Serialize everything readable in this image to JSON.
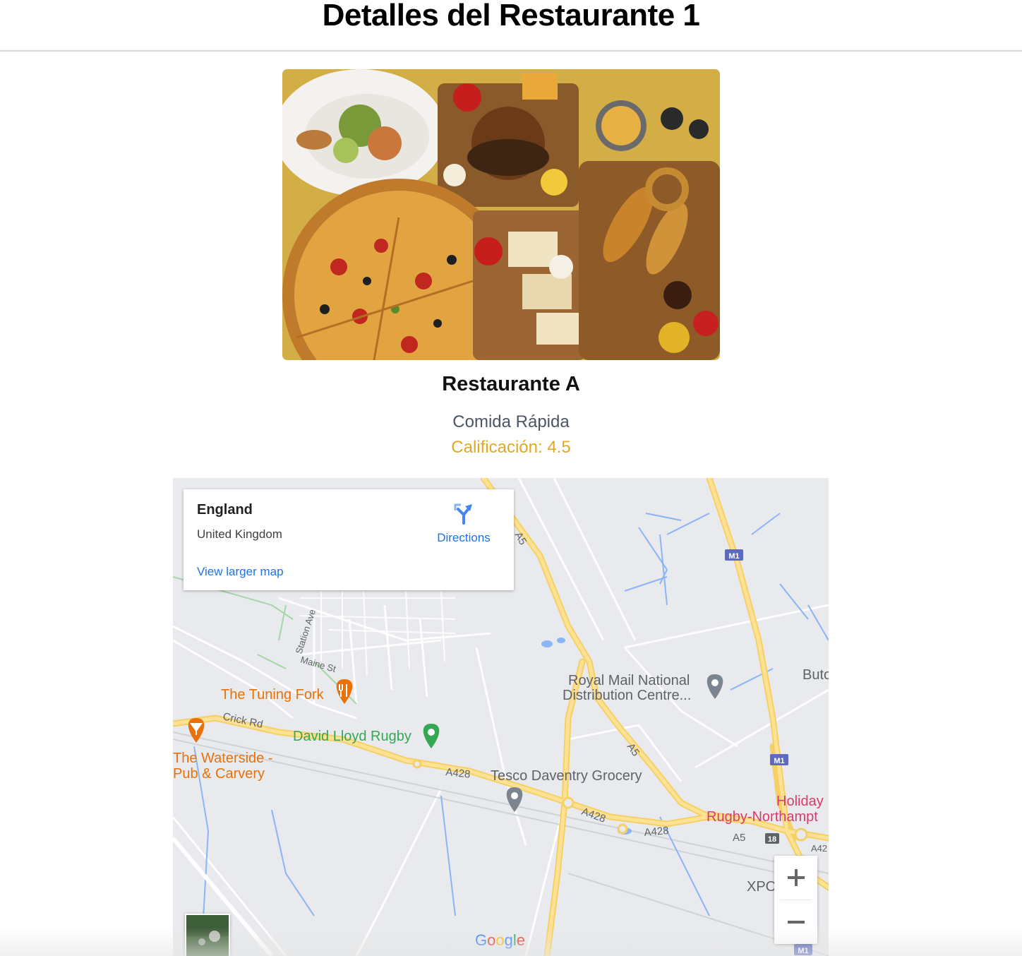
{
  "header": {
    "title": "Detalles del Restaurante 1"
  },
  "restaurant": {
    "name": "Restaurante A",
    "category": "Comida Rápida",
    "rating_label": "Calificación: 4.5",
    "image_icon": "food-platter-photo"
  },
  "map": {
    "card": {
      "title": "England",
      "subtitle": "United Kingdom",
      "directions_label": "Directions",
      "larger_map_label": "View larger map"
    },
    "labels": {
      "tuning_fork": "The Tuning Fork",
      "waterside_1": "The Waterside -",
      "waterside_2": "Pub & Carvery",
      "david_lloyd": "David Lloyd Rugby",
      "royal_mail_1": "Royal Mail National",
      "royal_mail_2": "Distribution Centre...",
      "tesco": "Tesco Daventry Grocery",
      "holiday_1": "Holiday",
      "holiday_2": "Rugby-Northampt",
      "but": "Buto",
      "xpo": "XPO",
      "station_ave": "Station Ave",
      "maine_st": "Maine St",
      "crick_rd": "Crick Rd",
      "road_a428_1": "A428",
      "road_a428_2": "A428",
      "road_a428_3": "A428",
      "road_a5_1": "A5",
      "road_a5_2": "A5",
      "road_a5_3": "A5",
      "road_m1_1": "M1",
      "road_m1_2": "M1",
      "road_m1_3": "M1",
      "road_18": "18",
      "road_a42": "A42"
    },
    "zoom_in": "+",
    "zoom_out": "−",
    "attribution": "Google",
    "colors": {
      "land": "#e8eaed",
      "major_road": "#fdd663",
      "motorway_badge": "#5c6bc0",
      "water": "#8ab4f8",
      "food_poi": "#e8710a",
      "park_poi": "#34a853",
      "hotel_poi": "#d93b6b"
    }
  },
  "colors": {
    "rating": "#e0a925",
    "category": "#4b5563",
    "link": "#1a73e8"
  }
}
